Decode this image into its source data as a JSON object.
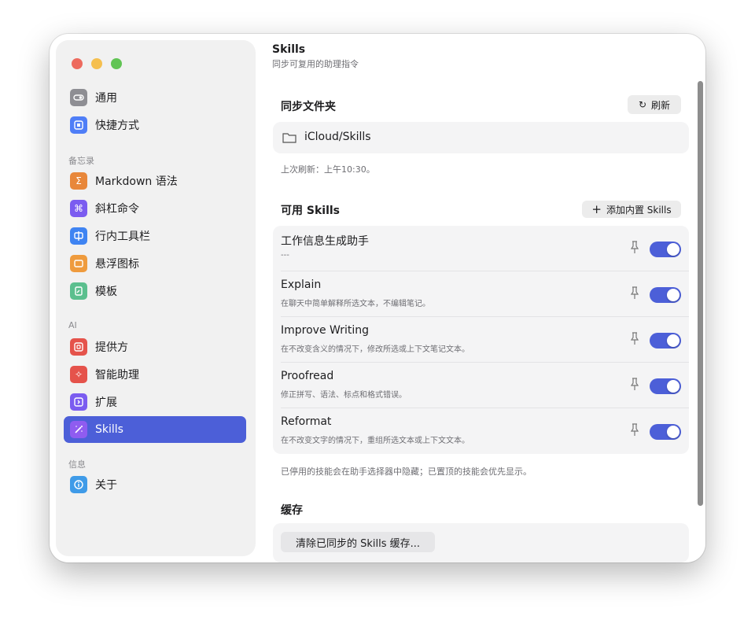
{
  "sidebar": {
    "items": [
      {
        "label": "通用",
        "icon": "toggle-icon",
        "color": "#8e8e93"
      },
      {
        "label": "快捷方式",
        "icon": "keyboard-icon",
        "color": "#4f7ef7"
      },
      {
        "label": "Markdown 语法",
        "icon": "sigma-icon",
        "color": "#e8873a"
      },
      {
        "label": "斜杠命令",
        "icon": "command-icon",
        "color": "#7b5cf0"
      },
      {
        "label": "行内工具栏",
        "icon": "toolbar-icon",
        "color": "#3f84f2"
      },
      {
        "label": "悬浮图标",
        "icon": "floating-window-icon",
        "color": "#ef9b3d"
      },
      {
        "label": "模板",
        "icon": "template-icon",
        "color": "#5bbf8e"
      },
      {
        "label": "提供方",
        "icon": "provider-icon",
        "color": "#e5534b"
      },
      {
        "label": "智能助理",
        "icon": "sparkle-icon",
        "color": "#e5534b"
      },
      {
        "label": "扩展",
        "icon": "extension-icon",
        "color": "#7b5cf0"
      },
      {
        "label": "Skills",
        "icon": "magic-wand-icon",
        "color": "#8f5cf0",
        "active": true
      },
      {
        "label": "关于",
        "icon": "info-icon",
        "color": "#3f9be8"
      }
    ],
    "sections": [
      "备忘录",
      "AI",
      "信息"
    ]
  },
  "header": {
    "title": "Skills",
    "subtitle": "同步可复用的助理指令"
  },
  "sync": {
    "heading": "同步文件夹",
    "refresh_label": "刷新",
    "folder_path": "iCloud/Skills",
    "last_refresh": "上次刷新：上午10:30。"
  },
  "available": {
    "heading": "可用 Skills",
    "add_label": "添加内置 Skills",
    "skills": [
      {
        "name": "工作信息生成助手",
        "desc": "---",
        "enabled": true
      },
      {
        "name": "Explain",
        "desc": "在聊天中简单解释所选文本，不编辑笔记。",
        "enabled": true
      },
      {
        "name": "Improve Writing",
        "desc": "在不改变含义的情况下，修改所选或上下文笔记文本。",
        "enabled": true
      },
      {
        "name": "Proofread",
        "desc": "修正拼写、语法、标点和格式错误。",
        "enabled": true
      },
      {
        "name": "Reformat",
        "desc": "在不改变文字的情况下，重组所选文本或上下文文本。",
        "enabled": true
      }
    ],
    "note": "已停用的技能会在助手选择器中隐藏；已置顶的技能会优先显示。"
  },
  "cache": {
    "heading": "缓存",
    "clear_label": "清除已同步的 Skills 缓存..."
  },
  "colors": {
    "accent": "#4c5fd8"
  }
}
